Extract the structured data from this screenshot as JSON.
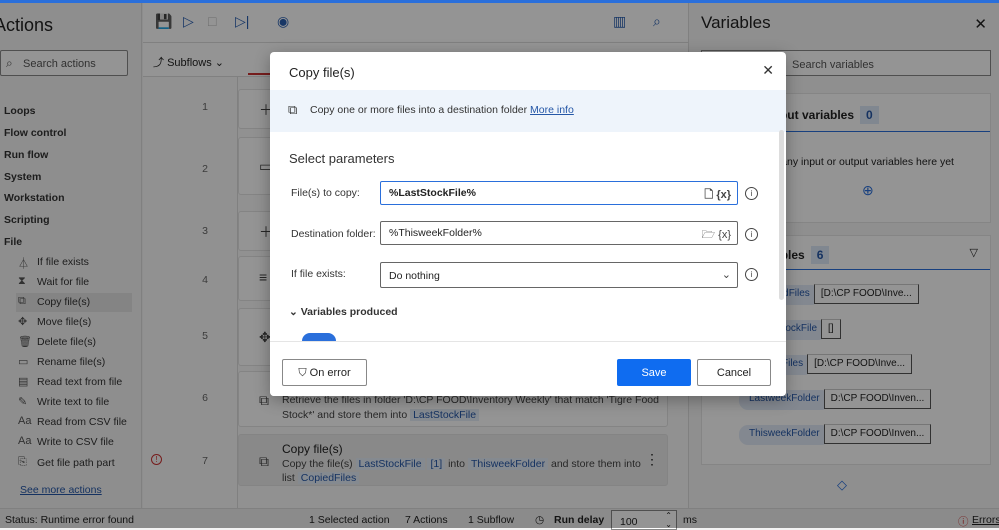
{
  "actions_panel": {
    "title": "Actions",
    "search_placeholder": "Search actions",
    "categories": [
      "Loops",
      "Flow control",
      "Run flow",
      "System",
      "Workstation",
      "Scripting",
      "File"
    ],
    "file_actions": [
      {
        "label": "If file exists",
        "icon": "branch-icon"
      },
      {
        "label": "Wait for file",
        "icon": "hourglass-icon"
      },
      {
        "label": "Copy file(s)",
        "icon": "copy-icon"
      },
      {
        "label": "Move file(s)",
        "icon": "move-icon"
      },
      {
        "label": "Delete file(s)",
        "icon": "trash-icon"
      },
      {
        "label": "Rename file(s)",
        "icon": "rename-icon"
      },
      {
        "label": "Read text from file",
        "icon": "read-file-icon"
      },
      {
        "label": "Write text to file",
        "icon": "write-file-icon"
      },
      {
        "label": "Read from CSV file",
        "icon": "text-icon"
      },
      {
        "label": "Write to CSV file",
        "icon": "text-icon"
      },
      {
        "label": "Get file path part",
        "icon": "file-path-icon"
      }
    ],
    "see_more": "See more actions"
  },
  "designer": {
    "subflows_label": "Subflows",
    "line_numbers": [
      "1",
      "2",
      "3",
      "4",
      "5",
      "6",
      "7"
    ],
    "step6": {
      "line1": "Retrieve the files in folder 'D:\\CP FOOD\\Inventory Weekly' that match 'Tigre Food",
      "line2_a": "Stock*' and store them into",
      "var": "LastStockFile"
    },
    "step7": {
      "title": "Copy file(s)",
      "a": "Copy the file(s)",
      "var1": "LastStockFile",
      "idx": "[1]",
      "b": "into",
      "var2": "ThisweekFolder",
      "c": "and store them into list",
      "var3": "CopiedFiles"
    }
  },
  "variables_panel": {
    "title": "Variables",
    "search_placeholder": "Search variables",
    "io_title": "Input / output variables",
    "io_count": "0",
    "io_empty": "There aren't any input or output variables here yet",
    "flow_title": "Flow variables",
    "flow_count": "6",
    "items": [
      {
        "name": "CopiedFiles",
        "value": "[D:\\CP FOOD\\Inve..."
      },
      {
        "name": "LastStockFile",
        "value": "[]"
      },
      {
        "name": "StockFiles",
        "value": "[D:\\CP FOOD\\Inve..."
      },
      {
        "name": "LastweekFolder",
        "value": "D:\\CP FOOD\\Inven..."
      },
      {
        "name": "ThisweekFolder",
        "value": "D:\\CP FOOD\\Inven..."
      }
    ]
  },
  "dialog": {
    "title": "Copy file(s)",
    "description": "Copy one or more files into a destination folder",
    "more_info": "More info",
    "section": "Select parameters",
    "files_label": "File(s) to copy:",
    "files_value": "%LastStockFile%",
    "dest_label": "Destination folder:",
    "dest_value": "%ThisweekFolder%",
    "exists_label": "If file exists:",
    "exists_value": "Do nothing",
    "var_token": "{x}",
    "vars_produced": "Variables produced",
    "on_error": "On error",
    "save": "Save",
    "cancel": "Cancel"
  },
  "status_bar": {
    "status": "Status: Runtime error found",
    "selected": "1 Selected action",
    "actions": "7 Actions",
    "subflows": "1 Subflow",
    "run_delay_label": "Run delay",
    "run_delay_value": "100",
    "unit": "ms",
    "errors": "Errors"
  },
  "colors": {
    "accent": "#2a6fdb",
    "link": "#2557a7"
  }
}
